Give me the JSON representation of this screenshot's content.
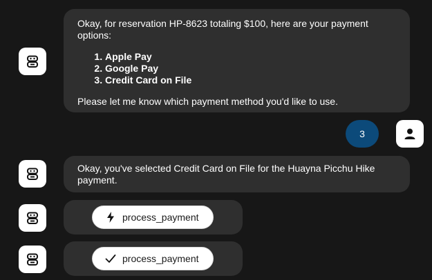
{
  "messages": {
    "assistant_payment_options": {
      "intro": "Okay, for reservation HP-8623 totaling $100, here are your payment options:",
      "options": [
        "Apple Pay",
        "Google Pay",
        "Credit Card on File"
      ],
      "outro": "Please let me know which payment method you'd like to use."
    },
    "user_choice": "3",
    "assistant_confirmation": "Okay, you've selected Credit Card on File for the Huayna Picchu Hike payment.",
    "tool_call_running": {
      "icon": "bolt-icon",
      "label": "process_payment"
    },
    "tool_call_done": {
      "icon": "check-icon",
      "label": "process_payment"
    }
  },
  "icons": {
    "assistant_avatar": "robot-icon",
    "user_avatar": "person-icon"
  },
  "colors": {
    "background": "#171717",
    "bubble": "#2f2f2f",
    "user_bubble": "#0c4a7a",
    "avatar_bg": "#ffffff"
  }
}
